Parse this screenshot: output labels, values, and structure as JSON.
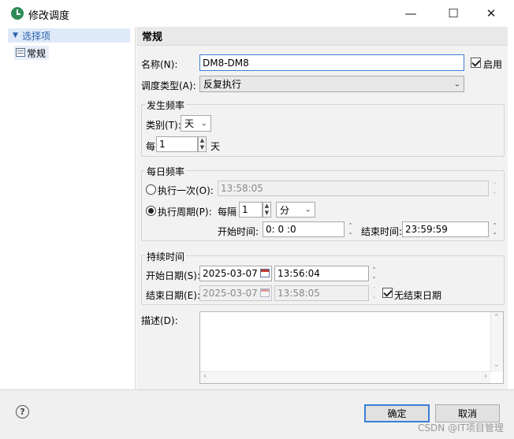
{
  "window": {
    "title": "修改调度"
  },
  "tree": {
    "root": "选择项",
    "item": "常规"
  },
  "section": {
    "title": "常规"
  },
  "form": {
    "name_label": "名称(N):",
    "name_value": "DM8-DM8",
    "enable_label": "启用",
    "enable_checked": true,
    "type_label": "调度类型(A):",
    "type_value": "反复执行"
  },
  "occurrence": {
    "group_label": "发生频率",
    "category_label": "类别(T):",
    "category_value": "天",
    "every_label": "每",
    "every_value": "1",
    "every_unit": "天"
  },
  "daily": {
    "group_label": "每日频率",
    "once_label": "执行一次(O):",
    "once_value": "13:58:05",
    "period_label": "执行周期(P):",
    "interval_label": "每隔",
    "interval_value": "1",
    "interval_unit": "分",
    "start_label": "开始时间:",
    "start_value": "0: 0 :0",
    "end_label": "结束时间:",
    "end_value": "23:59:59",
    "selected": "period"
  },
  "duration": {
    "group_label": "持续时间",
    "start_date_label": "开始日期(S):",
    "start_date": "2025-03-07",
    "start_time": "13:56:04",
    "end_date_label": "结束日期(E):",
    "end_date": "2025-03-07",
    "end_time": "13:58:05",
    "no_end_label": "无结束日期",
    "no_end_checked": true
  },
  "description": {
    "label": "描述(D):",
    "value": ""
  },
  "footer": {
    "ok_label": "确定",
    "cancel_label": "取消",
    "help_glyph": "?"
  },
  "watermark": "CSDN @IT项目管理",
  "colors": {
    "accent": "#3c7fd6",
    "tree_text": "#2c62b0"
  }
}
